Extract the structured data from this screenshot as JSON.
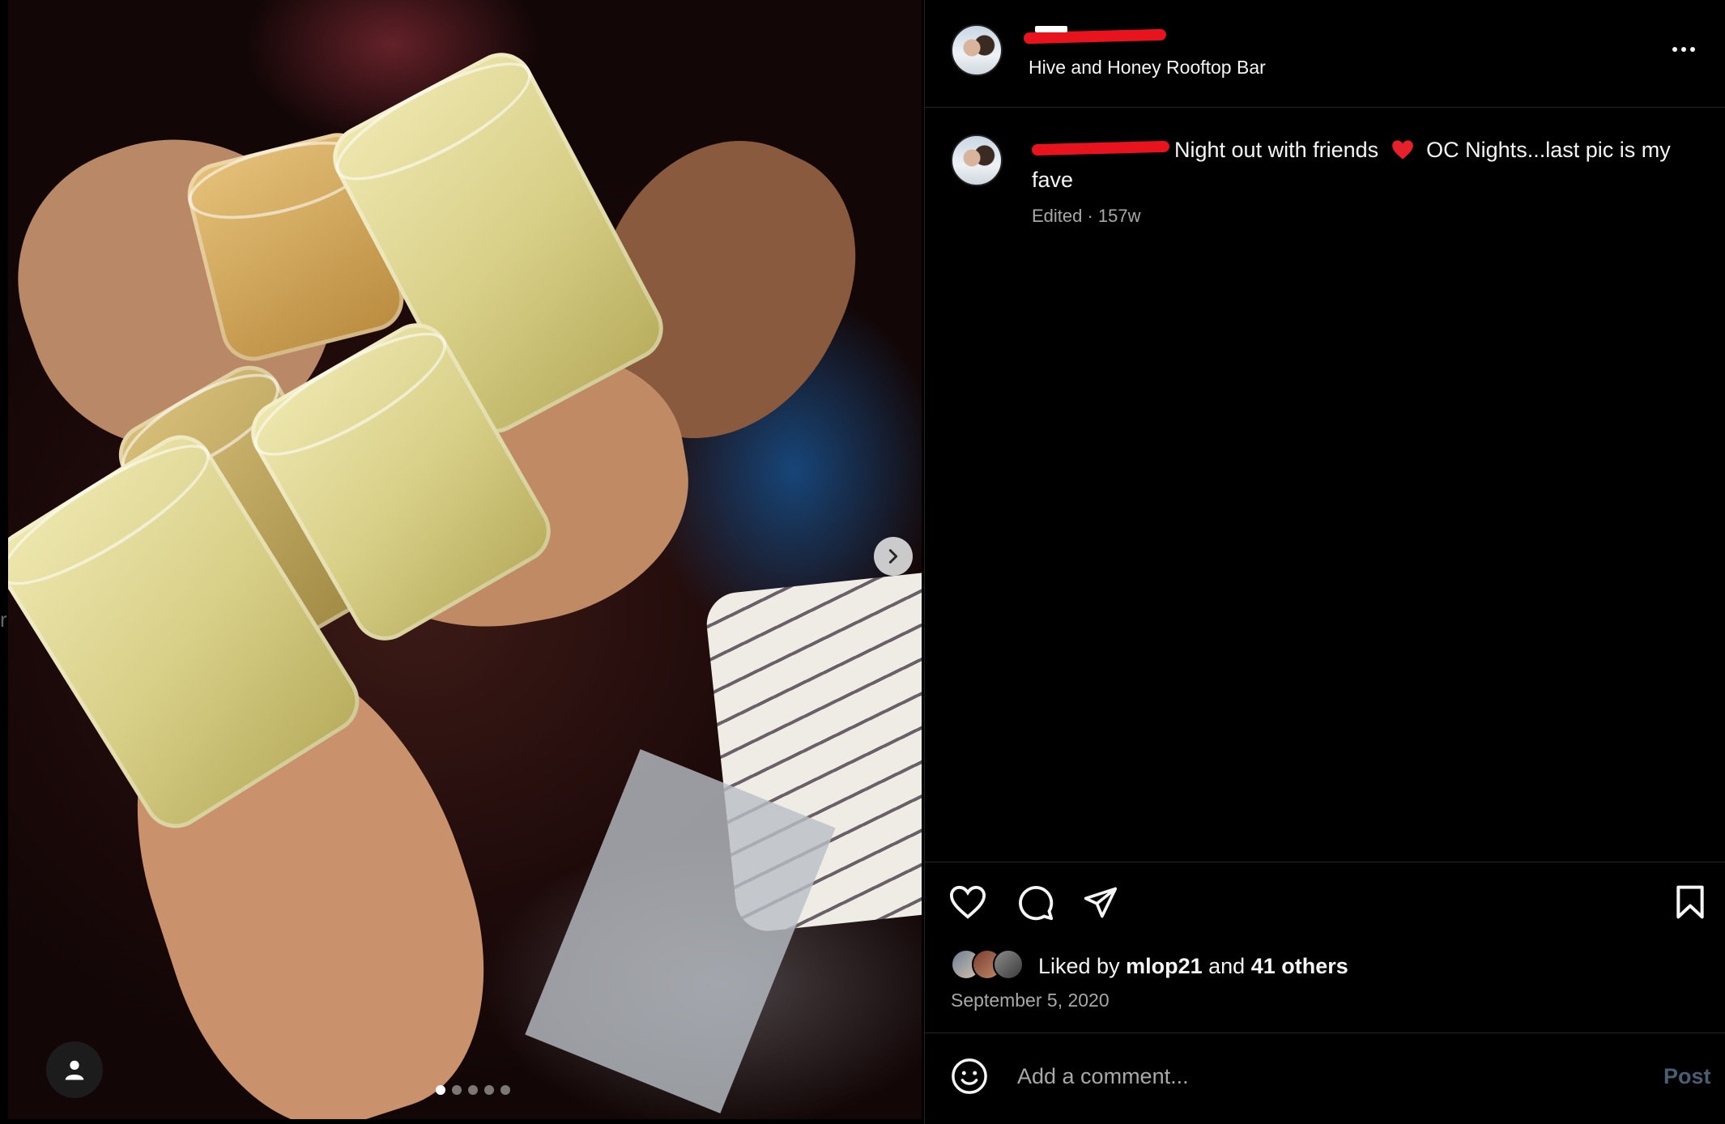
{
  "media": {
    "carousel_total": 5,
    "carousel_index": 1,
    "next_icon": "chevron-right-icon",
    "user_tag_icon": "person-icon"
  },
  "header": {
    "username": "",
    "location": "Hive and Honey Rooftop Bar",
    "more_icon": "more-horizontal-icon"
  },
  "caption": {
    "username": "",
    "text_part1": "Night out with friends",
    "emoji": "red-heart",
    "text_part2": "OC Nights...last pic is my",
    "text_part3": "fave",
    "meta": "Edited · 157w"
  },
  "actions": {
    "like_icon": "heart-icon",
    "comment_icon": "comment-bubble-icon",
    "share_icon": "paper-plane-icon",
    "save_icon": "bookmark-icon"
  },
  "likes": {
    "prefix": "Liked by",
    "first_user": "mlop21",
    "joiner": "and",
    "others": "41 others"
  },
  "post_date": "September 5, 2020",
  "comment": {
    "placeholder": "Add a comment...",
    "post_label": "Post",
    "emoji_icon": "smiley-icon"
  },
  "colors": {
    "background": "#000000",
    "text": "#f5f5f5",
    "muted": "#a8a8a8",
    "redaction": "#e8131c",
    "post_disabled": "#4a5d72"
  }
}
